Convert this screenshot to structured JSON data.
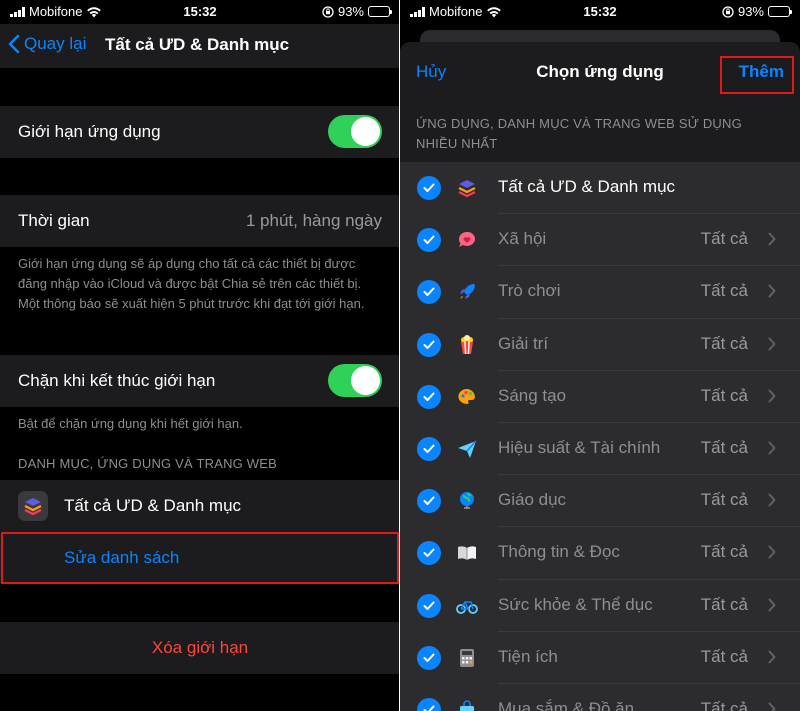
{
  "left": {
    "status": {
      "carrier": "Mobifone",
      "time": "15:32",
      "battery": "93%"
    },
    "nav": {
      "back_label": "Quay lại",
      "title": "Tất cả ƯD & Danh mục"
    },
    "app_limit": {
      "label": "Giới hạn ứng dụng",
      "enabled": true
    },
    "time_cell": {
      "label": "Thời gian",
      "value": "1 phút, hàng ngày"
    },
    "time_footnote": "Giới hạn ứng dụng sẽ áp dụng cho tất cả các thiết bị được đăng nhập vào iCloud và được bật Chia sẻ trên các thiết bị. Một thông báo sẽ xuất hiện 5 phút trước khi đạt tới giới hạn.",
    "block": {
      "label": "Chặn khi kết thúc giới hạn",
      "enabled": true
    },
    "block_footnote": "Bật để chặn ứng dụng khi hết giới hạn.",
    "section_header": "DANH MỤC, ỨNG DỤNG VÀ TRANG WEB",
    "all_apps_label": "Tất cả ƯD & Danh mục",
    "edit_list_label": "Sửa danh sách",
    "delete_limit_label": "Xóa giới hạn",
    "colors": {
      "accent": "#0a84ff",
      "toggle_on": "#30d158",
      "destructive": "#ff453a",
      "highlight": "#e01a1a"
    }
  },
  "right": {
    "status": {
      "carrier": "Mobifone",
      "time": "15:32",
      "battery": "93%"
    },
    "sheet": {
      "cancel_label": "Hủy",
      "title": "Chọn ứng dụng",
      "add_label": "Thêm",
      "header": "ỨNG DỤNG, DANH MỤC VÀ TRANG WEB SỬ DỤNG NHIỀU NHẤT"
    },
    "rows": [
      {
        "label": "Tất cả ƯD & Danh mục",
        "value": "",
        "icon": "stack-icon",
        "dim": false,
        "checked": true
      },
      {
        "label": "Xã hội",
        "value": "Tất cả",
        "icon": "chat-heart-icon",
        "dim": true,
        "checked": true
      },
      {
        "label": "Trò chơi",
        "value": "Tất cả",
        "icon": "rocket-icon",
        "dim": true,
        "checked": true
      },
      {
        "label": "Giải trí",
        "value": "Tất cả",
        "icon": "popcorn-icon",
        "dim": true,
        "checked": true
      },
      {
        "label": "Sáng tạo",
        "value": "Tất cả",
        "icon": "palette-icon",
        "dim": true,
        "checked": true
      },
      {
        "label": "Hiệu suất & Tài chính",
        "value": "Tất cả",
        "icon": "paper-plane-icon",
        "dim": true,
        "checked": true
      },
      {
        "label": "Giáo dục",
        "value": "Tất cả",
        "icon": "globe-icon",
        "dim": true,
        "checked": true
      },
      {
        "label": "Thông tin & Đọc",
        "value": "Tất cả",
        "icon": "book-icon",
        "dim": true,
        "checked": true
      },
      {
        "label": "Sức khỏe & Thể dục",
        "value": "Tất cả",
        "icon": "bicycle-icon",
        "dim": true,
        "checked": true
      },
      {
        "label": "Tiện ích",
        "value": "Tất cả",
        "icon": "calculator-icon",
        "dim": true,
        "checked": true
      },
      {
        "label": "Mua sắm & Đồ ăn",
        "value": "Tất cả",
        "icon": "shopping-bag-icon",
        "dim": true,
        "checked": true
      }
    ]
  }
}
